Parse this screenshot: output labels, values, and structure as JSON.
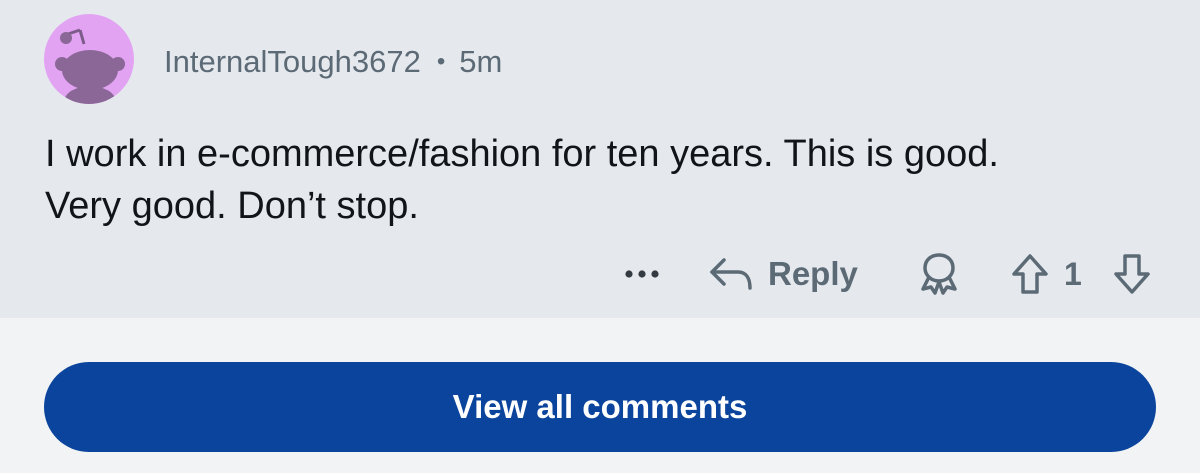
{
  "comment": {
    "username": "InternalTough3672",
    "separator": "•",
    "timestamp": "5m",
    "body_line1": "I work in e-commerce/fashion for ten years. This is good.",
    "body_line2": "Very good. Don’t stop."
  },
  "actions": {
    "more_icon": "more-horizontal-icon",
    "reply_icon": "reply-arrow-icon",
    "reply_label": "Reply",
    "award_icon": "award-icon",
    "upvote_icon": "upvote-arrow-icon",
    "vote_count": "1",
    "downvote_icon": "downvote-arrow-icon"
  },
  "footer": {
    "view_all_label": "View all comments"
  },
  "colors": {
    "card_background": "#e5e9ee",
    "page_background": "#f2f3f5",
    "button_background": "#0b449c",
    "avatar_background": "#e3a3f3",
    "muted_text": "#5c6a76"
  }
}
